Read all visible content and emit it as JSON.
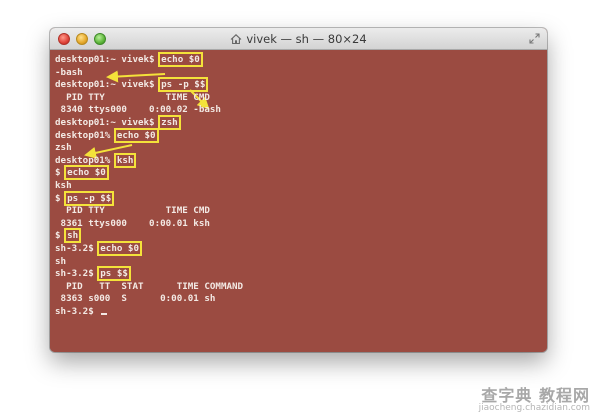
{
  "window": {
    "title": "vivek — sh — 80×24"
  },
  "terminal": {
    "background": "#9b4b41",
    "text_color": "#f3e9e4",
    "highlight_color": "#f4e23a",
    "lines": [
      {
        "prefix": "desktop01:~ vivek$ ",
        "cmd": "echo $0",
        "rest": ""
      },
      {
        "prefix": "-bash",
        "cmd": "",
        "rest": ""
      },
      {
        "prefix": "desktop01:~ vivek$ ",
        "cmd": "ps -p $$",
        "rest": ""
      },
      {
        "prefix": "  PID TTY           TIME CMD",
        "cmd": "",
        "rest": ""
      },
      {
        "prefix": " 8340 ttys000    0:00.02 -bash",
        "cmd": "",
        "rest": ""
      },
      {
        "prefix": "desktop01:~ vivek$ ",
        "cmd": "zsh",
        "rest": ""
      },
      {
        "prefix": "desktop01% ",
        "cmd": "echo $0",
        "rest": ""
      },
      {
        "prefix": "zsh",
        "cmd": "",
        "rest": ""
      },
      {
        "prefix": "desktop01% ",
        "cmd": "ksh",
        "rest": ""
      },
      {
        "prefix": "$ ",
        "cmd": "echo $0",
        "rest": ""
      },
      {
        "prefix": "ksh",
        "cmd": "",
        "rest": ""
      },
      {
        "prefix": "$ ",
        "cmd": "ps -p $$",
        "rest": ""
      },
      {
        "prefix": "  PID TTY           TIME CMD",
        "cmd": "",
        "rest": ""
      },
      {
        "prefix": " 8361 ttys000    0:00.01 ksh",
        "cmd": "",
        "rest": ""
      },
      {
        "prefix": "$ ",
        "cmd": "sh",
        "rest": ""
      },
      {
        "prefix": "sh-3.2$ ",
        "cmd": "echo $0",
        "rest": ""
      },
      {
        "prefix": "sh",
        "cmd": "",
        "rest": ""
      },
      {
        "prefix": "sh-3.2$ ",
        "cmd": "ps $$",
        "rest": ""
      },
      {
        "prefix": "  PID   TT  STAT      TIME COMMAND",
        "cmd": "",
        "rest": ""
      },
      {
        "prefix": " 8363 s000  S      0:00.01 sh",
        "cmd": "",
        "rest": ""
      },
      {
        "prefix": "sh-3.2$ ",
        "cmd": "",
        "rest": "",
        "cursor": true
      }
    ]
  },
  "watermark": {
    "main": "查字典 教程网",
    "sub": "jiaocheng.chazidian.com"
  },
  "icons": {
    "home": "home-icon",
    "fullscreen": "fullscreen-icon"
  }
}
